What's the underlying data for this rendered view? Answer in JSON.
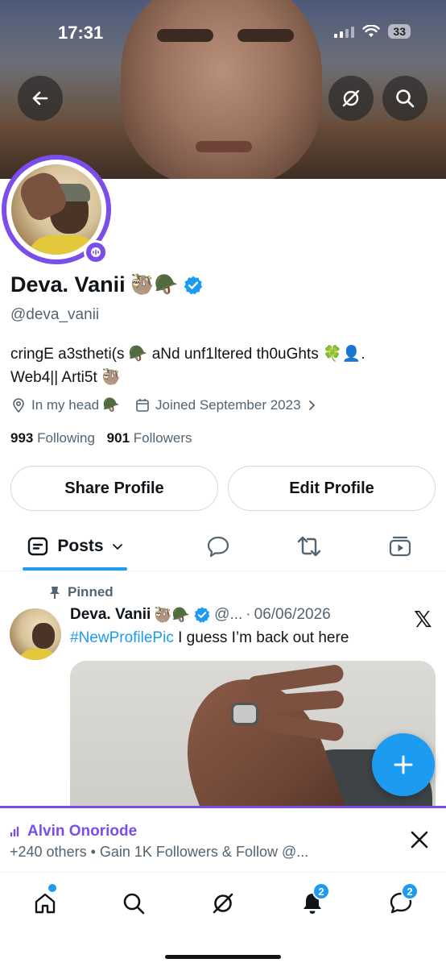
{
  "status_bar": {
    "time": "17:31",
    "battery": "33"
  },
  "profile": {
    "display_name": "Deva. Vanii",
    "name_emoji": "🦥🪖",
    "handle": "@deva_vanii",
    "bio_line1": "cringE a3stheti(s 🪖 aNd unf1ltered th0uGhts 🍀👤.",
    "bio_line2": "Web4|| Arti5t 🦥",
    "location": "In my head 🪖",
    "joined": "Joined September 2023",
    "following_count": "993",
    "following_label": "Following",
    "followers_count": "901",
    "followers_label": "Followers"
  },
  "buttons": {
    "share": "Share Profile",
    "edit": "Edit Profile"
  },
  "tabs": {
    "posts": "Posts"
  },
  "pinned_post": {
    "pinned_label": "Pinned",
    "author": "Deva. Vanii",
    "author_emoji": "🦥🪖",
    "handle_short": "@...",
    "separator": "·",
    "date": "06/06/2026",
    "hashtag": "#NewProfilePic",
    "text": " I guess I’m back out here",
    "source_mark": "𝕏"
  },
  "space_banner": {
    "host": "Alvin Onoriode",
    "subtitle": "+240 others • Gain 1K Followers & Follow @..."
  },
  "bottom_nav": {
    "notifications_badge": "2",
    "messages_badge": "2"
  },
  "colors": {
    "accent": "#1d9bf0",
    "spaces_purple": "#7a4ee8",
    "text": "#0f1419",
    "muted": "#536471"
  }
}
